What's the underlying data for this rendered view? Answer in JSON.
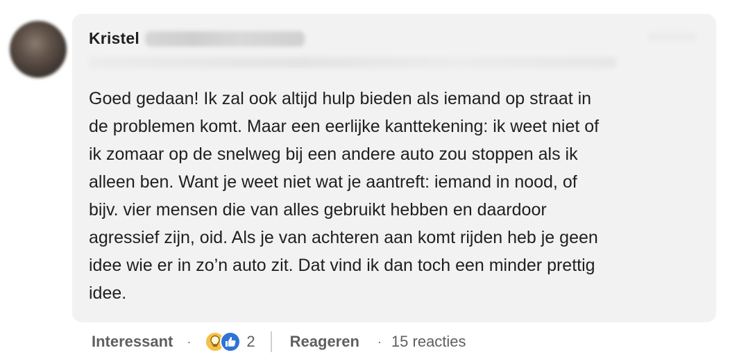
{
  "comment": {
    "author_first_name": "Kristel",
    "text": "Goed gedaan! Ik zal ook altijd hulp bieden als iemand op straat in\nde problemen komt. Maar een eerlijke kanttekening: ik weet niet of\nik zomaar op de snelweg bij een andere auto zou stoppen als ik\nalleen ben. Want je weet niet wat je aantreft: iemand in nood, of\nbijv. vier mensen die van alles gebruikt hebben en daardoor\nagressief zijn, oid. Als je van achteren aan komt rijden heb je geen\nidee wie er in zo’n auto zit. Dat vind ik dan toch een minder prettig\nidee."
  },
  "actions": {
    "react_label": "Interessant",
    "separator": "·",
    "reaction_icons": [
      "lightbulb-icon",
      "thumbs-up-icon"
    ],
    "reaction_count": "2",
    "reply_label": "Reageren",
    "replies_count_label": "15 reacties"
  },
  "colors": {
    "bubble_background": "#f2f2f2",
    "bulb_reaction": "#f5c04a",
    "like_reaction": "#2f73d6",
    "action_text": "#5f5f5f"
  }
}
